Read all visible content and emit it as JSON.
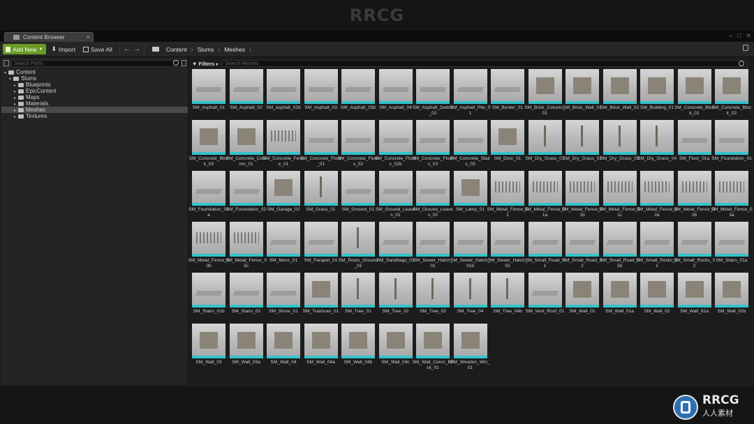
{
  "watermark_top": "RRCG",
  "window": {
    "tab_title": "Content Browser"
  },
  "toolbar": {
    "add_new_label": "Add New",
    "import_label": "Import",
    "save_all_label": "Save All",
    "breadcrumb": [
      "Content",
      "Slums",
      "Meshes"
    ]
  },
  "left_panel": {
    "search_placeholder": "Search Paths",
    "tree": [
      {
        "label": "Content",
        "level": 0,
        "selected": false
      },
      {
        "label": "Slums",
        "level": 1,
        "selected": false
      },
      {
        "label": "Blueprints",
        "level": 2,
        "selected": false
      },
      {
        "label": "EpicContent",
        "level": 2,
        "selected": false
      },
      {
        "label": "Maps",
        "level": 2,
        "selected": false
      },
      {
        "label": "Materials",
        "level": 2,
        "selected": false
      },
      {
        "label": "Meshes",
        "level": 2,
        "selected": true
      },
      {
        "label": "Textures",
        "level": 2,
        "selected": false
      }
    ]
  },
  "right_panel": {
    "filters_label": "Filters",
    "search_placeholder": "Search Meshes",
    "assets": [
      "SM_Asphalt_01",
      "SM_Asphalt_02",
      "SM_asphalt_02b",
      "SM_Asphalt_03",
      "SM_Asphalt_03b",
      "SM_Asphalt_04",
      "SM_Asphalt_Debris_02",
      "SM_Asphalt_Pile_01",
      "SM_Border_01",
      "SM_Brick_Column_01",
      "SM_Brick_Wall_01",
      "SM_Brick_Wall_02",
      "SM_Building_01",
      "SM_Concrete_Block_01",
      "SM_Concrete_Block_02",
      "SM_Concrete_Block_03",
      "SM_Concrete_Column_01",
      "SM_Concrete_Fence_01",
      "SM_Concrete_Floor_01",
      "SM_Concrete_Floors_02",
      "SM_Concrete_Floors_02b",
      "SM_Concrete_Floors_03",
      "SM_Concrete_Stairs_03",
      "SM_Door_01",
      "SM_Dry_Grass_01",
      "SM_Dry_Grass_02",
      "SM_Dry_Grass_03",
      "SM_Dry_Grass_04",
      "SM_Floor_01a",
      "SM_Foundation_01",
      "SM_Foundation_01a",
      "SM_Foundation_02",
      "SM_Garage_02",
      "SM_Grass_01",
      "SM_Ground_01",
      "SM_Ground_Leaves_01",
      "SM_Ground_Leaves_02",
      "SM_Lamp_01",
      "SM_Metal_Fence_01",
      "SM_Metal_Fence_01a",
      "SM_Metal_Fence_01b",
      "SM_Metal_Fence_01c",
      "SM_Metal_Fence_02a",
      "SM_Metal_Fence_02b",
      "SM_Metal_Fence_03a",
      "SM_Metal_Fence_03b",
      "SM_Metal_Fence_03c",
      "SM_Moss_01",
      "SM_Parapet_01",
      "SM_Roots_Ground_01",
      "SM_Sandbags_01",
      "SM_Sewer_Hatch_01",
      "SM_Sewer_Hatch_01b",
      "SM_Sewer_Hatch_02",
      "SM_Small_Road_01",
      "SM_Small_Road_02",
      "SM_Small_Road_02b",
      "SM_Small_Rocks_01",
      "SM_Small_Rocks_02",
      "SM_Stairs_01a",
      "SM_Stairs_01b",
      "SM_Stairs_02",
      "SM_Stone_01",
      "SM_Trashcan_01",
      "SM_Tree_01",
      "SM_Tree_02",
      "SM_Tree_03",
      "SM_Tree_04",
      "SM_Tree_04b",
      "SM_Vent_Roof_01",
      "SM_Wall_01",
      "SM_Wall_01a",
      "SM_Wall_02",
      "SM_Wall_02a",
      "SM_Wall_02b",
      "SM_Wall_03",
      "SM_Wall_03a",
      "SM_Wall_04",
      "SM_Wall_04a",
      "SM_Wall_04b",
      "SM_Wall_04c",
      "SM_Wall_Concr_Brick_01",
      "SM_Wooden_Win_01"
    ]
  },
  "brand_bottom": {
    "name": "RRCG",
    "sub": "人人素材"
  },
  "colors": {
    "accent_bar": "#33c3c9",
    "add_new_green": "#6a9a24"
  }
}
